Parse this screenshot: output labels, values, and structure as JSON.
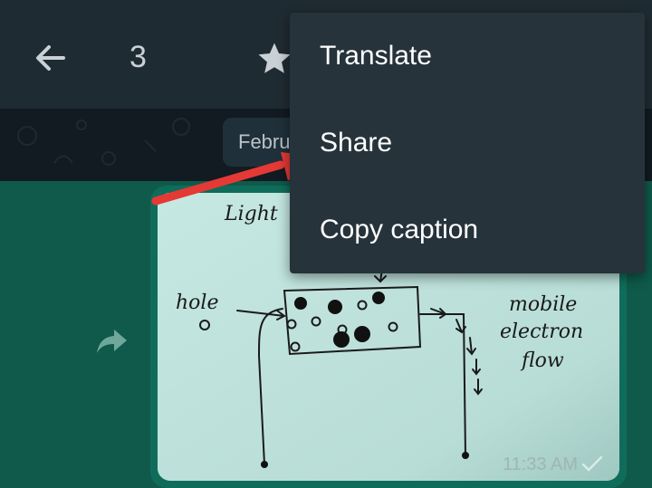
{
  "toolbar": {
    "back_icon": "arrow-left-icon",
    "selected_count": "3",
    "star_icon": "star-icon"
  },
  "date_chip": {
    "label": "Febru"
  },
  "message": {
    "forward_icon": "forward-icon",
    "image": {
      "sketch_labels": {
        "light": "Light",
        "hole": "hole",
        "mobile": "mobile",
        "electron": "electron",
        "flow": "flow"
      }
    },
    "time": "11:33 AM",
    "status_icon": "check-icon"
  },
  "context_menu": {
    "items": [
      {
        "label": "Translate"
      },
      {
        "label": "Share"
      },
      {
        "label": "Copy caption"
      }
    ]
  },
  "annotation": {
    "arrow_color": "#e53935"
  }
}
